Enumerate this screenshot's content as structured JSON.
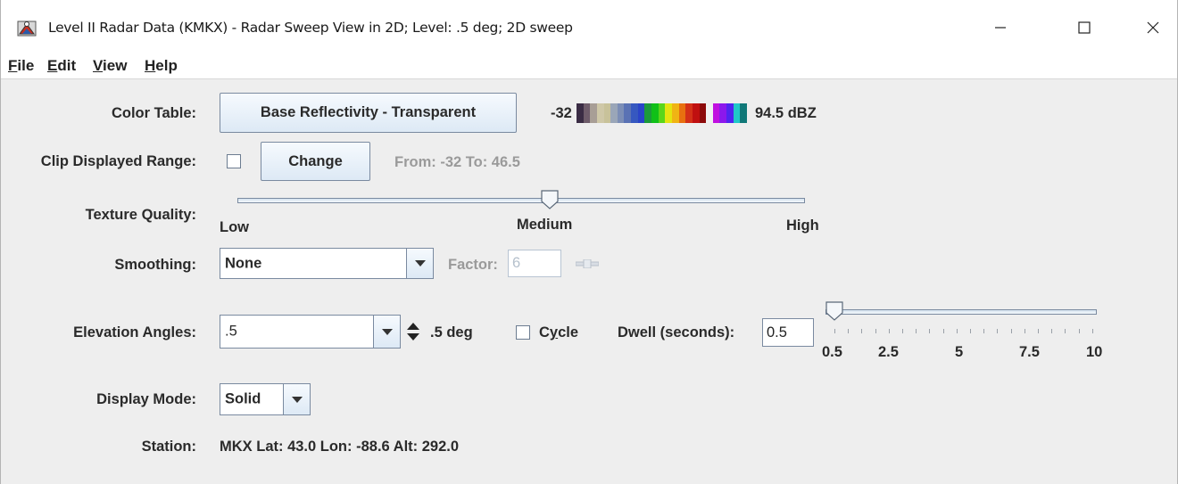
{
  "window": {
    "title": "Level II Radar Data (KMKX) - Radar Sweep View in 2D; Level: .5 deg; 2D sweep"
  },
  "menu": [
    {
      "first": "F",
      "rest": "ile"
    },
    {
      "first": "E",
      "rest": "dit"
    },
    {
      "first": "V",
      "rest": "iew"
    },
    {
      "first": "H",
      "rest": "elp"
    }
  ],
  "color_table": {
    "label": "Color Table:",
    "button": "Base Reflectivity - Transparent",
    "min": "-32",
    "max": "94.5 dBZ",
    "colors": [
      "#3a2c44",
      "#6e5c6a",
      "#a89e96",
      "#cfc8a8",
      "#c8c29a",
      "#9aa6b8",
      "#7c8eb6",
      "#5a72b4",
      "#3658c0",
      "#2a44c8",
      "#1c9a3a",
      "#10c018",
      "#5ad61a",
      "#e4e410",
      "#f0b414",
      "#e87010",
      "#d43018",
      "#c01010",
      "#8c0a0a",
      "#f0f0f0",
      "#c010e0",
      "#8c18ec",
      "#5024f0",
      "#20c8c8",
      "#107878"
    ]
  },
  "clip": {
    "label": "Clip Displayed Range:",
    "checked": false,
    "button": "Change",
    "range_text": "From: -32 To: 46.5"
  },
  "texture": {
    "label": "Texture Quality:",
    "low": "Low",
    "medium": "Medium",
    "high": "High",
    "value_fraction": 0.55
  },
  "smoothing": {
    "label": "Smoothing:",
    "value": "None",
    "factor_label": "Factor:",
    "factor_value": "6"
  },
  "elevation": {
    "label": "Elevation Angles:",
    "value": ".5",
    "readout": ".5 deg",
    "cycle_label_pre": "C",
    "cycle_label_mnemonic": "y",
    "cycle_label_post": "cle",
    "cycle_checked": false,
    "dwell_label": "Dwell (seconds):",
    "dwell_value": "0.5",
    "dwell_slider_value": 0.5,
    "dwell_ticks": [
      "0.5",
      "2.5",
      "5",
      "7.5",
      "10"
    ]
  },
  "display_mode": {
    "label": "Display Mode:",
    "value": "Solid"
  },
  "station": {
    "label": "Station:",
    "value": "MKX Lat: 43.0 Lon: -88.6 Alt: 292.0"
  }
}
